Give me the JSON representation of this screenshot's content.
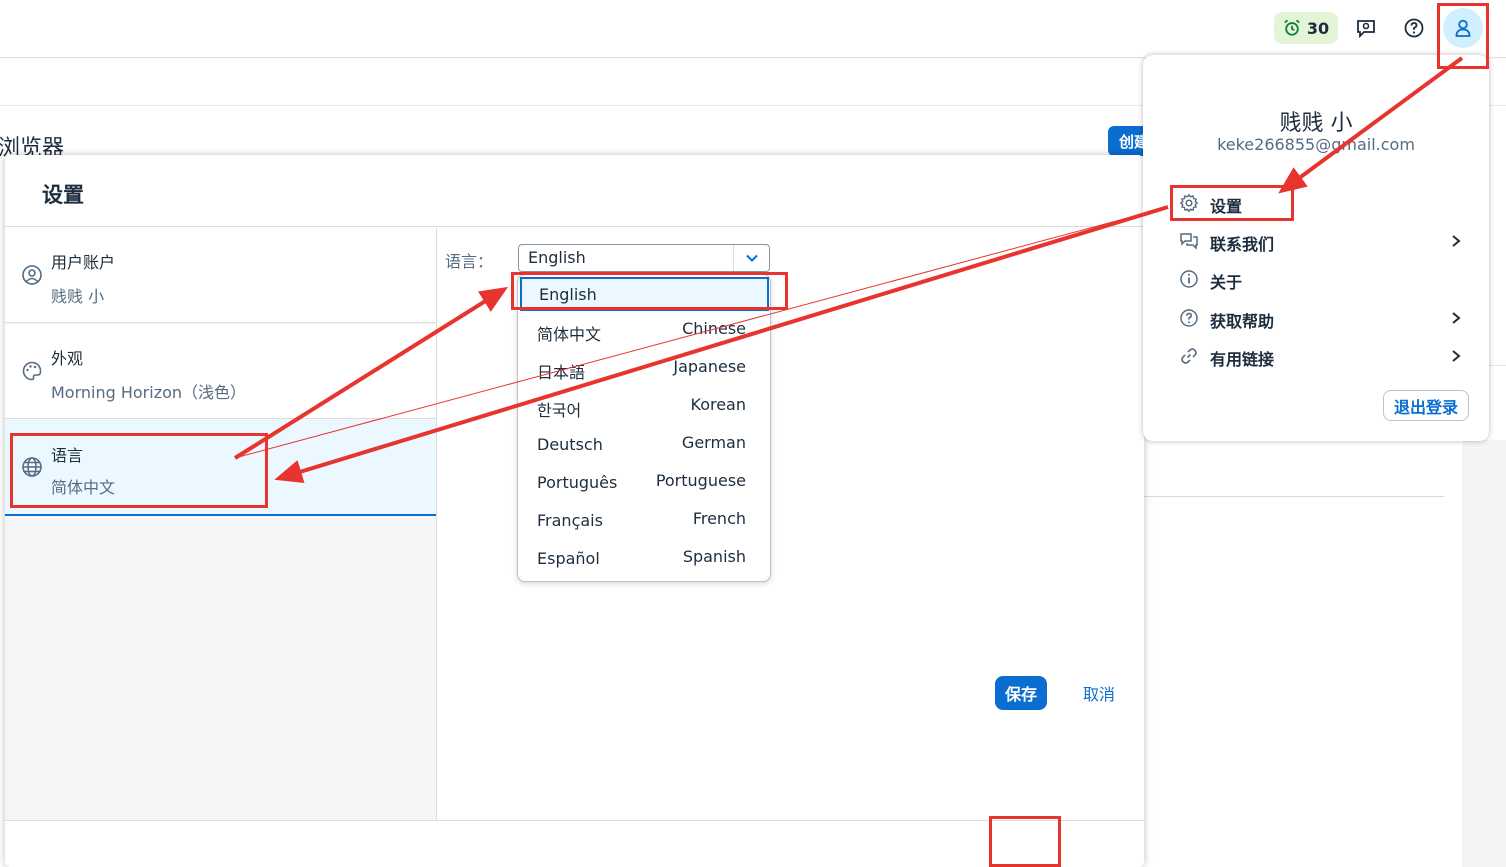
{
  "topbar": {
    "badge_count": "30",
    "badge_icon": "alarm-clock-icon",
    "feedback_icon": "feedback-icon",
    "help_icon": "help-icon",
    "profile_icon": "user-icon"
  },
  "background": {
    "page_title": "浏览器",
    "create_button": "创建"
  },
  "dialog": {
    "title": "设置",
    "nav": [
      {
        "title": "用户账户",
        "desc": "贱贱 小",
        "icon": "user-circle-icon"
      },
      {
        "title": "外观",
        "desc": "Morning Horizon（浅色）",
        "icon": "palette-icon"
      },
      {
        "title": "语言",
        "desc": "简体中文",
        "icon": "globe-icon"
      }
    ],
    "language_label": "语言：",
    "selected_language": "English",
    "options": [
      {
        "native": "English",
        "english": ""
      },
      {
        "native": "简体中文",
        "english": "Chinese"
      },
      {
        "native": "日本語",
        "english": "Japanese"
      },
      {
        "native": "한국어",
        "english": "Korean"
      },
      {
        "native": "Deutsch",
        "english": "German"
      },
      {
        "native": "Português",
        "english": "Portuguese"
      },
      {
        "native": "Français",
        "english": "French"
      },
      {
        "native": "Español",
        "english": "Spanish"
      }
    ],
    "save_label": "保存",
    "cancel_label": "取消"
  },
  "profile_menu": {
    "name": "贱贱 小",
    "email": "keke266855@gmail.com",
    "items": [
      {
        "label": "设置",
        "icon": "gear-icon",
        "submenu": false
      },
      {
        "label": "联系我们",
        "icon": "chat-icon",
        "submenu": true
      },
      {
        "label": "关于",
        "icon": "info-icon",
        "submenu": false
      },
      {
        "label": "获取帮助",
        "icon": "help-icon",
        "submenu": true
      },
      {
        "label": "有用链接",
        "icon": "link-icon",
        "submenu": true
      }
    ],
    "logout_label": "退出登录"
  },
  "colors": {
    "accent": "#0a6ed1",
    "annotation": "#e8342e",
    "selection": "#ebf8ff"
  }
}
